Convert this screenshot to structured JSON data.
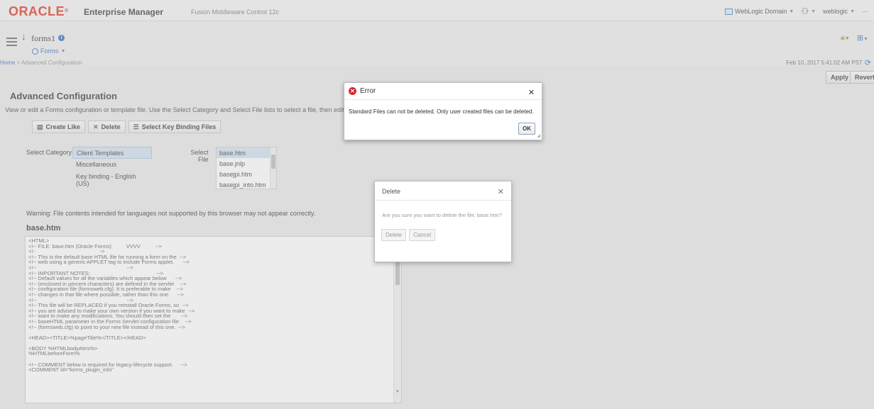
{
  "header": {
    "logo": "ORACLE",
    "logo_mark": "®",
    "product": "Enterprise Manager",
    "product_sub": "Fusion Middleware Control 12c",
    "domain_menu": "WebLogic Domain",
    "user_menu": "weblogic",
    "more": "···"
  },
  "target": {
    "name": "forms1",
    "menu": "Forms",
    "timestamp": "Feb 10, 2017 5:41:02 AM PST"
  },
  "breadcrumb": {
    "home": "Home",
    "separator": " > ",
    "current": "Advanced Configuration"
  },
  "actions": {
    "apply": "Apply",
    "revert": "Revert"
  },
  "page": {
    "title": "Advanced Configuration",
    "instructions": "View or edit a Forms configuration or template file. Use the Select Category and Select File lists to select a file, then edit."
  },
  "toolbar": {
    "create_like": "Create Like",
    "delete": "Delete",
    "select_key_binding": "Select Key Binding Files"
  },
  "category": {
    "label": "Select Category",
    "items": [
      "Client Templates",
      "Miscellaneous",
      "Key binding - English (US)"
    ]
  },
  "file": {
    "label_line1": "Select",
    "label_line2": "File",
    "items": [
      "base.htm",
      "base.jnlp",
      "basejpi.htm",
      "basejpi_into.htm"
    ]
  },
  "warning": "Warning: File contents intended for languages not supported by this browser may not appear correctly.",
  "filename": "base.htm",
  "editor_content": "<HTML>\n<!-- FILE: base.htm (Oracle Forms)          VVVV          -->\n<!-                                            ->\n<!-- This is the default base HTML file for running a form on the  -->\n<!-- web using a generic APPLET tag to include Forms applet.      -->\n<!--                                                             -->\n<!-- IMPORTANT NOTES:                                             -->\n<!-- Default values for all the variables which appear below      -->\n<!-- (enclosed in percent characters) are defined in the servlet    -->\n<!-- configuration file (formsweb.cfg). It is preferable to make    -->\n<!-- changes in that file where possible, rather than this one.     -->\n<!--                                                             -->\n<!-- This file will be REPLACED if you reinstall Oracle Forms, so  -->\n<!-- you are advised to make your own version if you want to make  -->\n<!-- want to make any modifications. You should then set the       -->\n<!-- baseHTML parameter in the Forms Servlet configuration file    -->\n<!-- (formsweb.cfg) to point to your new file instead of this one.  -->\n\n<HEAD><TITLE>%pageTitle%</TITLE></HEAD>\n\n<BODY %HTMLbodyAttrs%>\n%HTMLbeforeForm%\n\n<!-- COMMENT below is required for legacy-lifecycle support.     -->\n<COMMENT id=\"forms_plugin_info\"",
  "error_dialog": {
    "title": "Error",
    "close": "✕",
    "message": "Standard Files can not be deleted. Only user created files can be deleted.",
    "ok": "OK"
  },
  "delete_dialog": {
    "title": "Delete",
    "close": "✕",
    "message": "Are you sure you want to delete the file, base.htm?",
    "delete": "Delete",
    "cancel": "Cancel"
  },
  "icons": {
    "error": "error-circle-icon",
    "info": "info-icon",
    "lock": "lock-icon",
    "refresh": "refresh-icon",
    "menu": "hamburger-menu-icon"
  },
  "colors": {
    "oracle_red": "#e0301e",
    "link_blue": "#2a6ebb",
    "error_red": "#d8262c",
    "selection": "#cfe0f1"
  }
}
